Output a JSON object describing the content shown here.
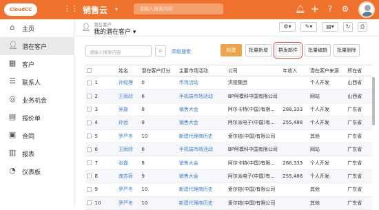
{
  "topbar": {
    "logo_text": "CloudCC",
    "app_title": "销售云",
    "search_placeholder": "请输入搜索内容",
    "icons": [
      "bell-icon",
      "plus-icon",
      "help-icon",
      "settings-icon"
    ]
  },
  "sidebar": {
    "items": [
      {
        "label": "主页",
        "icon": "home-icon"
      },
      {
        "label": "潜在客户",
        "icon": "person-icon",
        "active": true
      },
      {
        "label": "客户",
        "icon": "building-icon"
      },
      {
        "label": "联系人",
        "icon": "contact-icon"
      },
      {
        "label": "业务机会",
        "icon": "opportunity-icon"
      },
      {
        "label": "报价单",
        "icon": "quote-icon"
      },
      {
        "label": "合同",
        "icon": "contract-icon"
      },
      {
        "label": "报表",
        "icon": "report-icon"
      },
      {
        "label": "仪表板",
        "icon": "dashboard-icon"
      }
    ]
  },
  "header": {
    "crumb_small": "潜在客户",
    "view_title": "我的潜在客户"
  },
  "toolbar": {
    "search_placeholder": "请输入搜索内容",
    "advanced_search": "高级搜索",
    "new_btn": "新建",
    "batch_add": "批量新增",
    "group_mail": "群发邮件",
    "batch_edit": "批量编辑",
    "batch_delete": "批量删除"
  },
  "table": {
    "columns": [
      "",
      "",
      "姓名",
      "潜在客户打分",
      "主要市场活动",
      "公司",
      "年收入",
      "潜在客户来源",
      "所在省"
    ],
    "rows": [
      {
        "n": "1",
        "name": "孙经理",
        "score": "0",
        "activity": "市场活动",
        "company": "洪德集团",
        "revenue": "",
        "source": "个人开发",
        "province": "山西省"
      },
      {
        "n": "2",
        "name": "王雨欣",
        "score": "6",
        "activity": "手机端市场活动",
        "company": "BP阿模科中国有限公司",
        "revenue": "",
        "source": "网站",
        "province": "山西省"
      },
      {
        "n": "3",
        "name": "吴磊",
        "score": "8",
        "activity": "销售大会",
        "company": "阿尔卡特(中国)有限...",
        "revenue": "288,333",
        "source": "个人开发",
        "province": "广东省"
      },
      {
        "n": "4",
        "name": "孙远",
        "score": "9",
        "activity": "销售大会",
        "company": "阿尔派电子(中国)有...",
        "revenue": "255,488",
        "source": "个人开发",
        "province": "广东省"
      },
      {
        "n": "5",
        "name": "罗严冬",
        "score": "10",
        "activity": "新建代理商历史",
        "company": "爱尔铂(中国)有限公司",
        "revenue": "",
        "source": "其他",
        "province": "广东省"
      },
      {
        "n": "6",
        "name": "王雨欣",
        "score": "6",
        "activity": "手机端市场活动",
        "company": "BP阿模科中国有限公司",
        "revenue": "",
        "source": "网站",
        "province": "广东省"
      },
      {
        "n": "7",
        "name": "张磊",
        "score": "8",
        "activity": "销售大会",
        "company": "阿尔卡特(中国)有限...",
        "revenue": "288,333",
        "source": "个人开发",
        "province": "广东省"
      },
      {
        "n": "8",
        "name": "庞苏荷",
        "score": "9",
        "activity": "销售大会",
        "company": "阿尔派电子(中国)有...",
        "revenue": "255,488",
        "source": "个人开发",
        "province": "广东省"
      },
      {
        "n": "9",
        "name": "罗严冬",
        "score": "10",
        "activity": "新建代理商历史",
        "company": "爱尔铂(中国)有限公司",
        "revenue": "",
        "source": "其他",
        "province": "广东省"
      },
      {
        "n": "10",
        "name": "罗严冬",
        "score": "10",
        "activity": "新建代理商历史",
        "company": "爱尔铂(中国)有限公司",
        "revenue": "",
        "source": "其他",
        "province": "广东省"
      }
    ]
  }
}
